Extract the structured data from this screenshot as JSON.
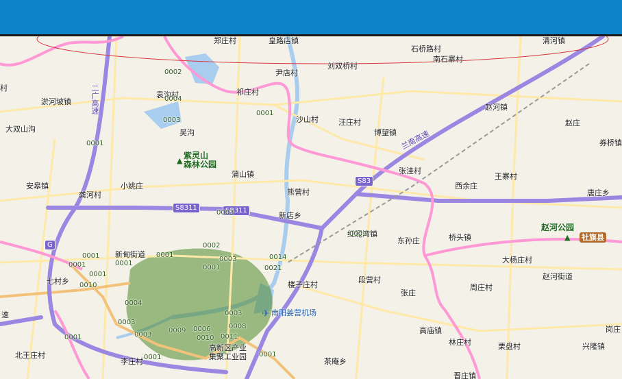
{
  "colors": {
    "header": "#0d83c9",
    "expressway": "#9b86e2",
    "provincial_road": "#f3c27a",
    "county_road": "#ffe9a8",
    "boundary": "#ff99d6",
    "water": "#a9cdef",
    "urban": "#4f8a2a",
    "highlight_ellipse": "#d9363e"
  },
  "icons": {
    "park": "tree-icon",
    "airport": "airplane-icon"
  },
  "labels": {
    "zhengzhuang": "郑庄村",
    "huanglu": "皇路店镇",
    "shiqiaolu": "石桥路村",
    "qinghe": "清河镇",
    "nanshizhai": "南石寨村",
    "liushuangqiao": "刘双桥村",
    "yindian": "尹店村",
    "qizhuang": "祁庄村",
    "yuangou": "袁沟村",
    "liuhepo": "淤河坡镇",
    "dashuangshangou": "大双山沟",
    "wugou": "吴沟",
    "shashan": "沙山村",
    "wangzhuang": "汪庄村",
    "bowang": "博望镇",
    "zhaohe": "赵河镇",
    "zhaozhuang": "赵庄",
    "quanqiao": "券桥镇",
    "zhangwa": "张洼村",
    "xiyu": "西余庄",
    "wangzhai": "王寨村",
    "tangzhuang": "唐庄乡",
    "anhao": "安皋镇",
    "gonghe": "龚河村",
    "xiaoyao": "小姚庄",
    "pushan": "蒲山镇",
    "xiongying": "熊营村",
    "xindian": "新店乡",
    "honghuwan": "红泥湾镇",
    "dongsun": "东孙庄",
    "qiaotou": "桥头镇",
    "dayangzhuang": "大杨庄村",
    "zhaohejie": "赵河街道",
    "xindianjie": "新甸街道",
    "louzi": "楼子庄村",
    "duanying": "段营村",
    "zhang": "张庄",
    "zhouzhuang": "周庄村",
    "gaodian": "高庙镇",
    "linzhuang": "林庄村",
    "lipan": "栗盘村",
    "xinglong": "兴隆镇",
    "gangzhuang": "岗庄",
    "beiwangzhuang": "北王庄村",
    "lizhuang": "李庄村",
    "gaoxin": "高新区产业",
    "gaoxin2": "集聚工业园",
    "chadian": "茶庵乡",
    "jinzhuang": "晋庄镇",
    "qicun": "七村乡",
    "airport": "南阳姜营机场",
    "park": "紫灵山",
    "park2": "森林公园",
    "zhaohepark": "赵河公园",
    "sheqi": "社旗县",
    "wcun": "村",
    "su": "速"
  },
  "expressways": {
    "s8311a": "S8311",
    "s8311b": "S8311",
    "s83": "S83",
    "g_west": "G",
    "lanan": "兰南高速",
    "erguang": "二广高速"
  },
  "numbers": [
    "0002",
    "0004",
    "0003",
    "0001",
    "0001",
    "0003",
    "0002",
    "0001",
    "0001",
    "0001",
    "0001",
    "0010",
    "0001",
    "0003",
    "0014",
    "0021",
    "0001",
    "0002",
    "0003",
    "0004",
    "0001",
    "0009",
    "0006",
    "0003",
    "0010",
    "0011",
    "0008",
    "0003",
    "0001",
    "0001"
  ]
}
